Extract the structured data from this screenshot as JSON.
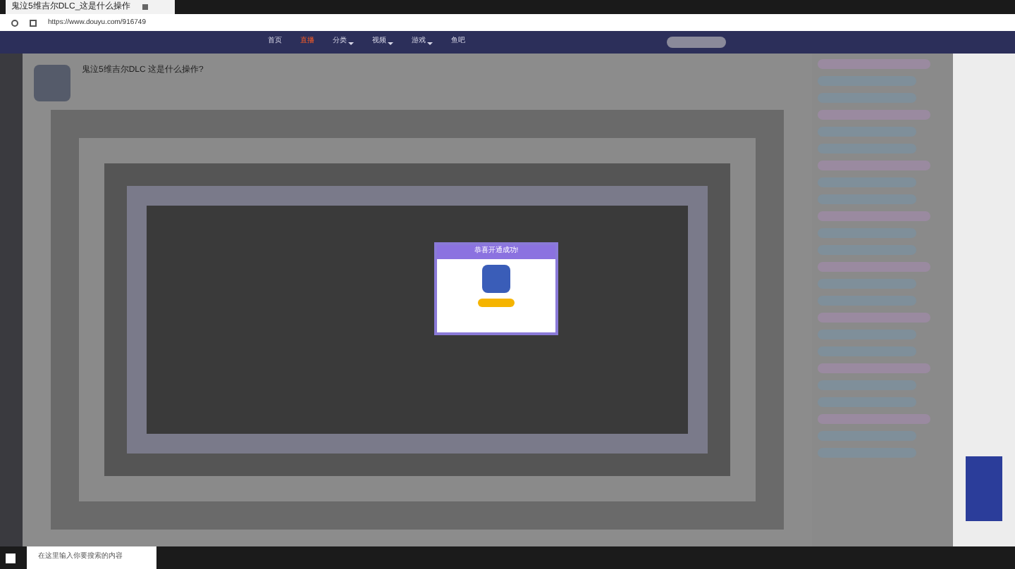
{
  "browser": {
    "tab_title": "鬼泣5维吉尔DLC_这是什么操作",
    "url": "https://www.douyu.com/916749"
  },
  "nav": [
    {
      "label": "首页",
      "selected": false,
      "dropdown": false
    },
    {
      "label": "直播",
      "selected": true,
      "dropdown": false
    },
    {
      "label": "分类",
      "selected": false,
      "dropdown": true
    },
    {
      "label": "视频",
      "selected": false,
      "dropdown": true
    },
    {
      "label": "游戏",
      "selected": false,
      "dropdown": true
    },
    {
      "label": "鱼吧",
      "selected": false,
      "dropdown": false
    }
  ],
  "stream": {
    "title": "鬼泣5维吉尔DLC 这是什么操作?"
  },
  "modal": {
    "title": "恭喜开通成功!"
  },
  "taskbar": {
    "search_placeholder": "在这里输入你要搜索的内容"
  }
}
